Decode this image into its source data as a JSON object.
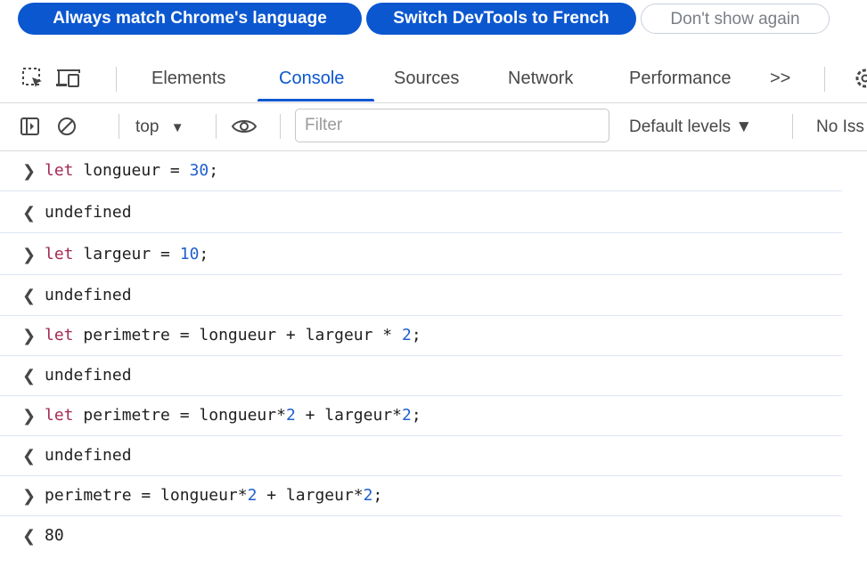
{
  "banner": {
    "always_match": "Always match Chrome's language",
    "switch_french": "Switch DevTools to French",
    "dont_show": "Don't show again"
  },
  "tabs": {
    "elements": "Elements",
    "console": "Console",
    "sources": "Sources",
    "network": "Network",
    "performance": "Performance",
    "more": ">>"
  },
  "toolbar": {
    "context": "top",
    "filter_placeholder": "Filter",
    "levels": "Default levels ▼",
    "issues": "No Iss"
  },
  "console": {
    "entries": [
      {
        "type": "input",
        "keyword": "let",
        "text": " longueur = ",
        "number": "30",
        "suffix": ";"
      },
      {
        "type": "output",
        "text": "undefined"
      },
      {
        "type": "input",
        "keyword": "let",
        "text": " largeur = ",
        "number": "10",
        "suffix": ";"
      },
      {
        "type": "output",
        "text": "undefined"
      },
      {
        "type": "input",
        "keyword": "let",
        "text": " perimetre = longueur + largeur * ",
        "number": "2",
        "suffix": ";"
      },
      {
        "type": "output",
        "text": "undefined"
      },
      {
        "type": "input",
        "keyword": "let",
        "text": " perimetre = longueur*",
        "number": "2",
        "text2": " + largeur*",
        "number2": "2",
        "suffix": ";"
      },
      {
        "type": "output",
        "text": "undefined"
      },
      {
        "type": "input",
        "keyword": "",
        "text": "perimetre = longueur*",
        "number": "2",
        "text2": " + largeur*",
        "number2": "2",
        "suffix": ";"
      },
      {
        "type": "result",
        "text": "80"
      }
    ]
  },
  "colors": {
    "accent": "#0b57d0",
    "keyword": "#a42a56",
    "number": "#1f5fd0",
    "undefined": "#8e8e8e"
  }
}
